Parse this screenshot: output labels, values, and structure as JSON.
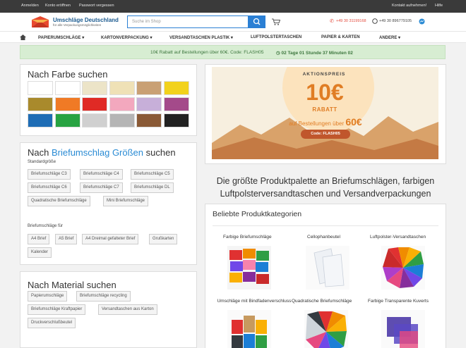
{
  "topbar": {
    "login": "Anmelden",
    "register": "Konto eröffnen",
    "forgot": "Passwort vergessen",
    "contact": "Kontakt aufnehmen!",
    "help": "Hilfe"
  },
  "logo": {
    "title": "Umschläge Deutschland",
    "subtitle": "für alle Verpackungsmöglichkeiten"
  },
  "search": {
    "placeholder": "Suche im Shop"
  },
  "contact": {
    "phone": "+49 30 31199168",
    "whatsapp": "+49 30 896779105"
  },
  "nav": {
    "items": [
      "PAPIERUMSCHLÄGE",
      "KARTONVERPACKUNG",
      "VERSANDTASCHEN PLASTIK",
      "LUFTPOLSTERTASCHEN",
      "PAPIER & KARTEN",
      "ANDERE"
    ]
  },
  "promo": {
    "text": "10€ Rabatt auf Bestellungen über 60€. Code: FLASH05",
    "timer": "02 Tage 01 Stunde 37 Minuten 02"
  },
  "colors": {
    "title": "Nach Farbe suchen",
    "swatches": [
      "#ffffff",
      "#ffffff",
      "#ece4c8",
      "#efe1b6",
      "#c9a074",
      "#f2d21c",
      "#a98a2c",
      "#f07a25",
      "#e02a25",
      "#f3a8be",
      "#c7afd9",
      "#a44a8a",
      "#1f6db5",
      "#28a342",
      "#d0d0d0",
      "#b5b5b5",
      "#8a5a36",
      "#222222"
    ]
  },
  "sizes": {
    "title_prefix": "Nach ",
    "title_highlight": "Briefumschlag Größen",
    "title_suffix": " suchen",
    "standard_label": "Standardgröße",
    "standard_tags": [
      "Briefumschläge C3",
      "Briefumschläge C4",
      "Briefumschläge C5",
      "Briefumschläge C6",
      "Briefumschläge C7",
      "Briefumschläge DL",
      "Quadratische Briefumschläge",
      "Mini Briefumschläge"
    ],
    "for_label": "Briefumschläge für",
    "for_tags": [
      "A4 Brief",
      "A5 Brief",
      "A4 Dreimal gefalteter Brief",
      "Grußkarten",
      "Kalender"
    ]
  },
  "material": {
    "title": "Nach Material suchen",
    "tags": [
      "Papierumschläge",
      "Briefumschläge recycling",
      "Briefumschläge Kraftpapier",
      "Versandtaschen aus Karton",
      "Druckverschlußbeutel"
    ]
  },
  "banner": {
    "top": "AKTIONSPREIS",
    "amount": "10€",
    "word": "RABATT",
    "sub_prefix": "auf Bestellungen über ",
    "sub_amount": "60€",
    "code": "Code: FLASH05"
  },
  "headline": "Die größte Produktpalette an Briefumschlägen, farbigen Luftpolsterversandtaschen und Versandverpackungen",
  "categories": {
    "title": "Beliebte Produktkategorien",
    "items": [
      "Farbige Briefumschläge",
      "Cellophanbeutel",
      "Luftpolster-Versandtaschen",
      "Umschläge mit Bindfadenverschluss",
      "Quadratische Briefumschläge",
      "Farbige Transparente Kuverts"
    ]
  }
}
